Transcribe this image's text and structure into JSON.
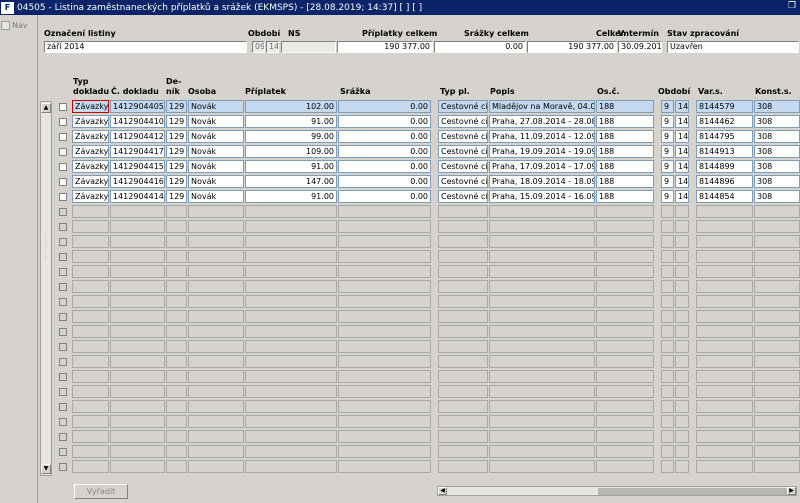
{
  "window": {
    "title": "04505 - Listina zaměstnaneckých příplatků a srážek (EKMSPS) - [28.08.2019; 14:37]  [ ]  [ ]",
    "app_icon": "F"
  },
  "nav": {
    "label": "Nav"
  },
  "header": {
    "labels": {
      "oznaceni": "Označení listiny",
      "obdobi": "Období",
      "ns": "NS",
      "priplatky": "Příplatky celkem",
      "srazky": "Srážky celkem",
      "celkem": "Celkem",
      "vtermin": "V. termín",
      "stav": "Stav zpracování"
    },
    "values": {
      "oznaceni": "září 2014",
      "obdobi_m": "09",
      "obdobi_d": "14",
      "ns": "",
      "priplatky": "190 377.00",
      "srazky": "0.00",
      "celkem": "190 377.00",
      "vtermin": "30.09.2014",
      "stav": "Uzavřen"
    }
  },
  "table": {
    "columns": {
      "typ": "Typ dokladu",
      "typ2": "dokladu",
      "typ1": "Typ",
      "cdokladu": "Č. dokladu",
      "denik1": "De-",
      "denik2": "ník",
      "osoba": "Osoba",
      "priplatek": "Příplatek",
      "srazka": "Srážka",
      "typpl": "Typ pl.",
      "popis": "Popis",
      "osc": "Os.č.",
      "obdobi": "Období",
      "vars": "Var.s.",
      "konsts": "Konst.s."
    },
    "rows": [
      {
        "typ": "Závazky",
        "doklad": "1412904405",
        "denik": "129",
        "osoba": "Novák",
        "priplatek": "102.00",
        "srazka": "0.00",
        "typpl": "Cestovné cic",
        "popis": "Mladějov na Moravě, 04.09.2",
        "osc": "188",
        "obd_m": "9",
        "obd_r": "14",
        "vars": "8144579",
        "konsts": "308"
      },
      {
        "typ": "Závazky",
        "doklad": "1412904410",
        "denik": "129",
        "osoba": "Novák",
        "priplatek": "91.00",
        "srazka": "0.00",
        "typpl": "Cestovné cic",
        "popis": "Praha, 27.08.2014 - 28.08.20",
        "osc": "188",
        "obd_m": "9",
        "obd_r": "14",
        "vars": "8144462",
        "konsts": "308"
      },
      {
        "typ": "Závazky",
        "doklad": "1412904412",
        "denik": "129",
        "osoba": "Novák",
        "priplatek": "99.00",
        "srazka": "0.00",
        "typpl": "Cestovné cic",
        "popis": "Praha, 11.09.2014 - 12.09.20",
        "osc": "188",
        "obd_m": "9",
        "obd_r": "14",
        "vars": "8144795",
        "konsts": "308"
      },
      {
        "typ": "Závazky",
        "doklad": "1412904417",
        "denik": "129",
        "osoba": "Novák",
        "priplatek": "109.00",
        "srazka": "0.00",
        "typpl": "Cestovné cic",
        "popis": "Praha, 19.09.2014 - 19.09.20",
        "osc": "188",
        "obd_m": "9",
        "obd_r": "14",
        "vars": "8144913",
        "konsts": "308"
      },
      {
        "typ": "Závazky",
        "doklad": "1412904415",
        "denik": "129",
        "osoba": "Novák",
        "priplatek": "91.00",
        "srazka": "0.00",
        "typpl": "Cestovné cic",
        "popis": "Praha, 17.09.2014 - 17.09.20",
        "osc": "188",
        "obd_m": "9",
        "obd_r": "14",
        "vars": "8144899",
        "konsts": "308"
      },
      {
        "typ": "Závazky",
        "doklad": "1412904416",
        "denik": "129",
        "osoba": "Novák",
        "priplatek": "147.00",
        "srazka": "0.00",
        "typpl": "Cestovné cic",
        "popis": "Praha, 18.09.2014 - 18.09.20",
        "osc": "188",
        "obd_m": "9",
        "obd_r": "14",
        "vars": "8144896",
        "konsts": "308"
      },
      {
        "typ": "Závazky",
        "doklad": "1412904414",
        "denik": "129",
        "osoba": "Novák",
        "priplatek": "91.00",
        "srazka": "0.00",
        "typpl": "Cestovné cic",
        "popis": "Praha, 15.09.2014 - 16.09.20",
        "osc": "188",
        "obd_m": "9",
        "obd_r": "14",
        "vars": "8144854",
        "konsts": "308"
      }
    ]
  },
  "footer": {
    "vyradit": "Vyřadit"
  },
  "icons": {
    "restore": "restore-icon",
    "scroll_up": "arrow-up-icon",
    "scroll_down": "arrow-down-icon",
    "scroll_left": "arrow-left-icon",
    "scroll_right": "arrow-right-icon"
  },
  "colors": {
    "titlebar": "#0a246a",
    "background": "#d6d3ce",
    "selected_row": "#c4d8f0",
    "focus": "#c00000"
  }
}
